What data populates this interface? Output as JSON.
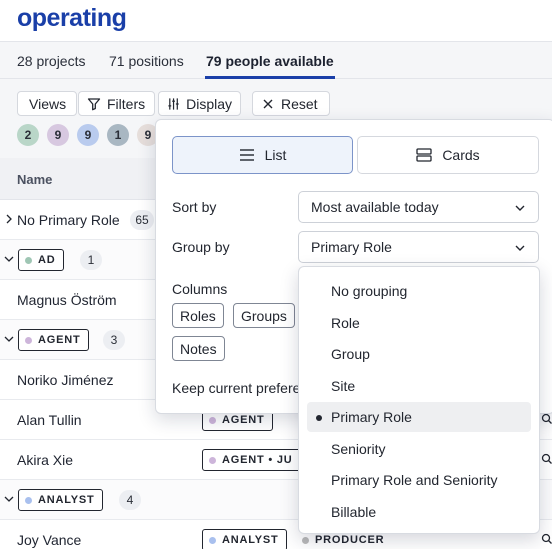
{
  "app": {
    "logo": "operating"
  },
  "tabs": [
    {
      "label": "28 projects"
    },
    {
      "label": "71 positions"
    },
    {
      "label": "79 people available"
    }
  ],
  "toolbar": {
    "views": "Views",
    "filters": "Filters",
    "display": "Display",
    "reset": "Reset"
  },
  "summary_chips": [
    {
      "count": "2",
      "color": "#b9d6c8"
    },
    {
      "count": "9",
      "color": "#d7c8e0"
    },
    {
      "count": "9",
      "color": "#b9cbee"
    },
    {
      "count": "1",
      "color": "#a9b7c2"
    },
    {
      "count": "9",
      "color": "#e6dedb"
    }
  ],
  "table": {
    "header_name": "Name",
    "rows": {
      "no_primary": {
        "label": "No Primary Role",
        "count": "65"
      },
      "group_ad": {
        "tag": "AD",
        "count": "1",
        "dot": "#9fc6b4"
      },
      "magnus": {
        "name": "Magnus Öström"
      },
      "group_agent": {
        "tag": "AGENT",
        "count": "3",
        "dot": "#cdb5da"
      },
      "noriko": {
        "name": "Noriko Jiménez"
      },
      "alan": {
        "name": "Alan Tullin",
        "tag": "AGENT"
      },
      "akira": {
        "name": "Akira Xie",
        "tag": "AGENT • JU"
      },
      "group_analyst": {
        "tag": "ANALYST",
        "count": "4",
        "dot": "#a9c0ee"
      },
      "joy": {
        "name": "Joy Vance",
        "tag1": "ANALYST",
        "tag2": "PRODUCER"
      }
    }
  },
  "display_panel": {
    "list_label": "List",
    "cards_label": "Cards",
    "sort_label": "Sort by",
    "sort_value": "Most available today",
    "group_label": "Group by",
    "group_value": "Primary Role",
    "columns_label": "Columns",
    "column_chips": [
      "Roles",
      "Groups",
      "Notes"
    ],
    "keep_label": "Keep current prefere"
  },
  "group_options": [
    "No grouping",
    "Role",
    "Group",
    "Site",
    "Primary Role",
    "Seniority",
    "Primary Role and Seniority",
    "Billable"
  ],
  "group_selected": "Primary Role"
}
